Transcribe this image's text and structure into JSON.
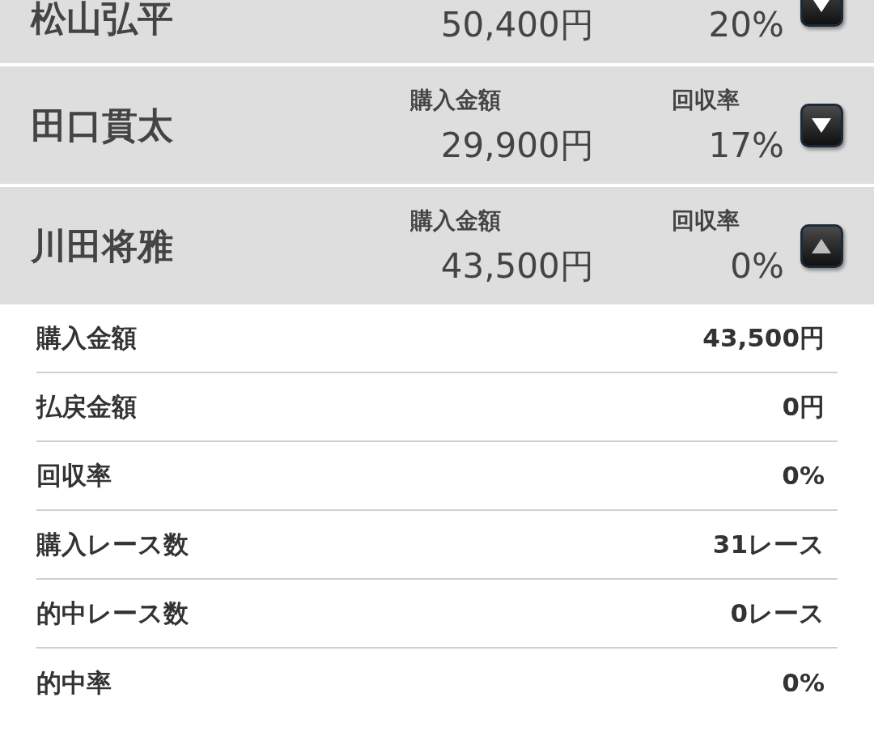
{
  "players": [
    {
      "name": "松山弘平",
      "amount": "50,400円",
      "rate": "20%",
      "expanded": false
    },
    {
      "name": "田口貫太",
      "amount_label": "購入金額",
      "amount": "29,900円",
      "rate_label": "回収率",
      "rate": "17%",
      "expanded": false
    },
    {
      "name": "川田将雅",
      "amount_label": "購入金額",
      "amount": "43,500円",
      "rate_label": "回収率",
      "rate": "0%",
      "expanded": true,
      "details": [
        {
          "label": "購入金額",
          "value": "43,500円"
        },
        {
          "label": "払戻金額",
          "value": "0円"
        },
        {
          "label": "回収率",
          "value": "0%"
        },
        {
          "label": "購入レース数",
          "value": "31レース"
        },
        {
          "label": "的中レース数",
          "value": "0レース"
        },
        {
          "label": "的中率",
          "value": "0%"
        }
      ]
    }
  ]
}
